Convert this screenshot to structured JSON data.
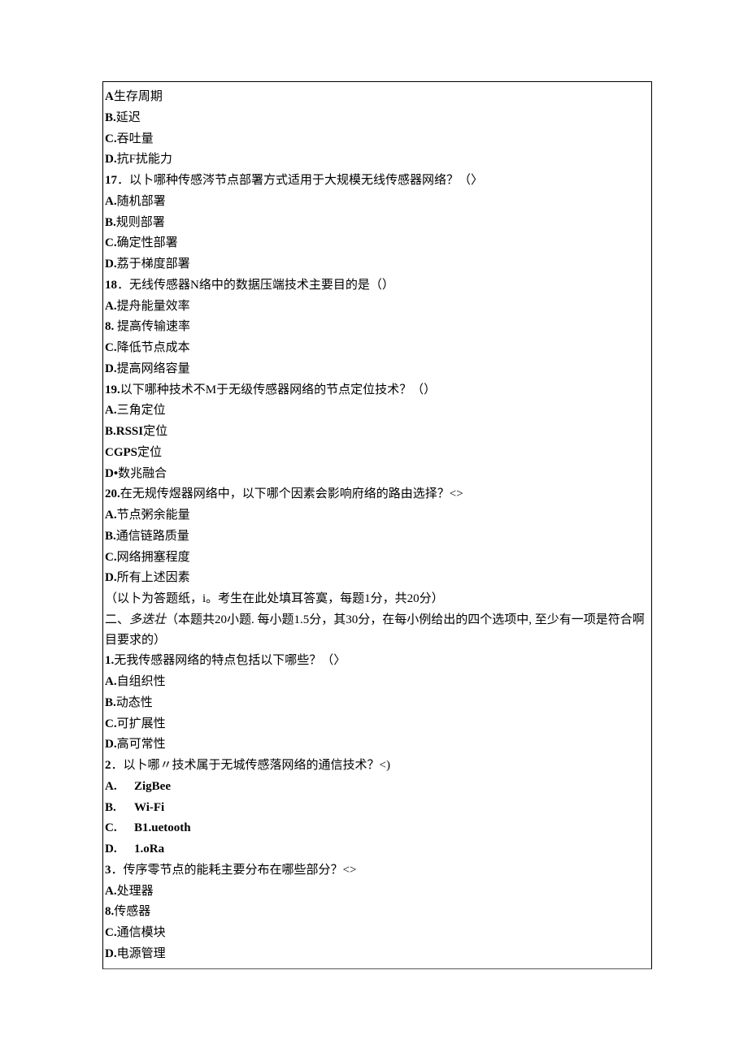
{
  "q16_options": {
    "A": {
      "letter": "A",
      "text": "生存周期"
    },
    "B": {
      "letter": "B.",
      "text": "延迟"
    },
    "C": {
      "letter": "C.",
      "text": "吞吐量"
    },
    "D": {
      "letter": "D.",
      "text": "抗F扰能力"
    }
  },
  "q17": {
    "num": "17",
    "stem": "．以卜哪种传感涔节点部署方式适用于大规模无线传感器网络？（〉",
    "A": {
      "letter": "A.",
      "text": "随机部署"
    },
    "B": {
      "letter": "B.",
      "text": "规则部署"
    },
    "C": {
      "letter": "C.",
      "text": "确定性部署"
    },
    "D": {
      "letter": "D.",
      "text": "荔于梯度部署"
    }
  },
  "q18": {
    "num": "18",
    "stem": "．无线传感器N络中的数据压端技术主要目的是（）",
    "A": {
      "letter": "A.",
      "text": "提舟能量效率"
    },
    "B": {
      "letter": "8.",
      "text": " 提高传输速率"
    },
    "C": {
      "letter": "C.",
      "text": "降低节点成本"
    },
    "D": {
      "letter": "D.",
      "text": "提高网络容量"
    }
  },
  "q19": {
    "num": "19.",
    "stem": "以下哪种技术不M于无级传感器网络的节点定位技术？（）",
    "A": {
      "letter": "A.",
      "text": "三角定位"
    },
    "B": {
      "letter": "B.RSSI",
      "text": "定位"
    },
    "C": {
      "letter": "CGPS",
      "text": "定位"
    },
    "D": {
      "letter": "D•",
      "text": "数兆融合"
    }
  },
  "q20": {
    "num": "20.",
    "stem": "在无规传煜器网络中，以下哪个因素会影响府络的路由选择？<>",
    "A": {
      "letter": "A.",
      "text": "节点粥余能量"
    },
    "B": {
      "letter": "B.",
      "text": "通信链路质量"
    },
    "C": {
      "letter": "C.",
      "text": "网络拥塞程度"
    },
    "D": {
      "letter": "D.",
      "text": "所有上述因素"
    }
  },
  "answer_sheet_note": "（以卜为答题纸，i。考生在此处填耳答寞，每题1分，共20分）",
  "section2": {
    "prefix": "二、",
    "title_italic": "多迭壮",
    "rest": "（本题共20小题. 每小题1.5分，其30分，在每小例给出的四个选项中, 至少有一项是符合啊目要求的）"
  },
  "m1": {
    "num": "1.",
    "stem": "无我传感器网络的特点包括以下哪些？（〉",
    "A": {
      "letter": "A.",
      "text": "自组织性"
    },
    "B": {
      "letter": "B.",
      "text": "动态性"
    },
    "C": {
      "letter": "C.",
      "text": "可扩展性"
    },
    "D": {
      "letter": "D.",
      "text": "高可常性"
    }
  },
  "m2": {
    "num": "2",
    "stem": "．以卜哪〃技术属于无城传感落网络的通信技术？<)",
    "A": {
      "letter": "A.",
      "text": "ZigBee"
    },
    "B": {
      "letter": "B.",
      "text": "Wi-Fi"
    },
    "C": {
      "letter": "C.",
      "text": "B1.uetooth"
    },
    "D": {
      "letter": "D.",
      "text": "1.oRa"
    }
  },
  "m3": {
    "num": "3",
    "stem": "．传序零节点的能耗主要分布在哪些部分？<>",
    "A": {
      "letter": "A.",
      "text": "处理器"
    },
    "B": {
      "letter": "8.",
      "text": "传感器"
    },
    "C": {
      "letter": "C.",
      "text": "通信模块"
    },
    "D": {
      "letter": "D.",
      "text": "电源管理"
    }
  }
}
